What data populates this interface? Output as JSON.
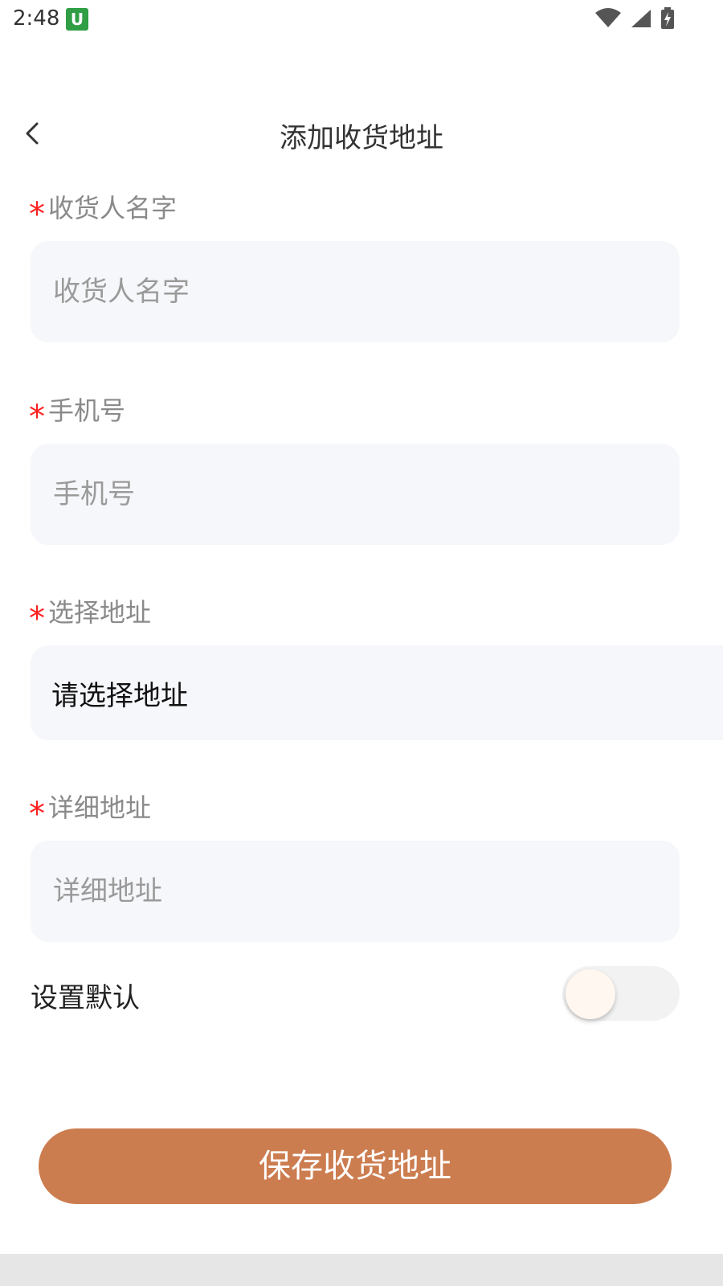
{
  "status_bar": {
    "time": "2:48",
    "app_badge": "U",
    "icons": [
      "wifi-icon",
      "signal-icon",
      "battery-charging-icon"
    ]
  },
  "header": {
    "title": "添加收货地址",
    "back_icon": "chevron-left-icon"
  },
  "form": {
    "required_mark": "*",
    "name": {
      "label": "收货人名字",
      "placeholder": "收货人名字",
      "value": ""
    },
    "phone": {
      "label": "手机号",
      "placeholder": "手机号",
      "value": ""
    },
    "region": {
      "label": "选择地址",
      "value": "请选择地址"
    },
    "detail": {
      "label": "详细地址",
      "placeholder": "详细地址",
      "value": ""
    },
    "default": {
      "label": "设置默认",
      "on": false
    }
  },
  "actions": {
    "save_label": "保存收货地址"
  },
  "colors": {
    "accent": "#cc7d50",
    "required": "#ff1f1f",
    "field_bg": "#f6f7fa"
  }
}
